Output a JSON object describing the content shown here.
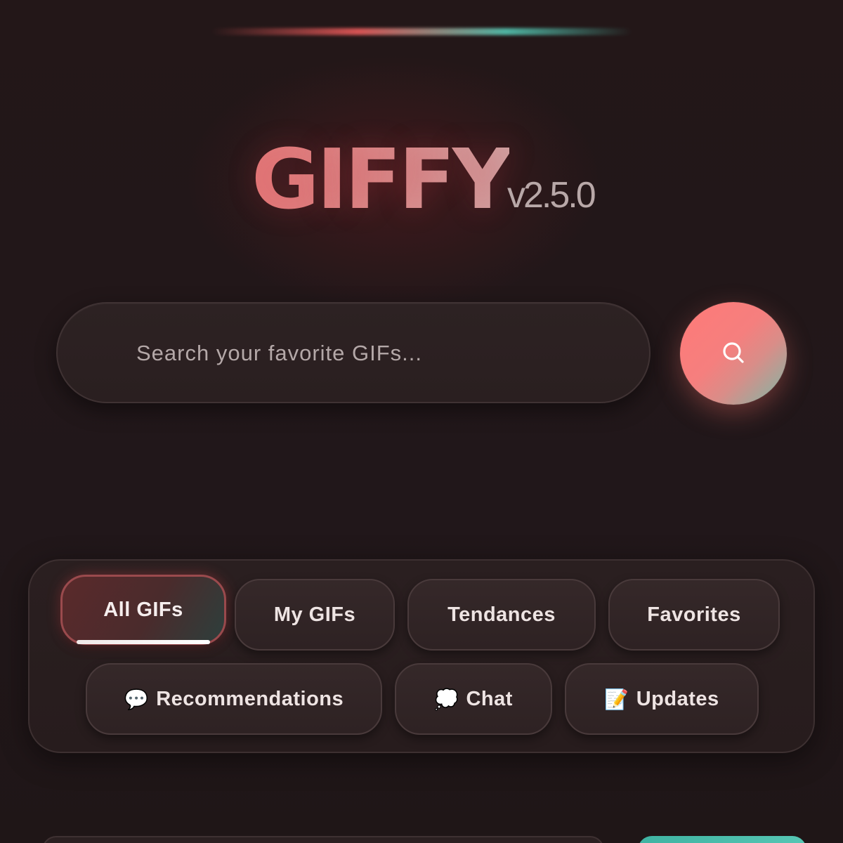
{
  "brand": {
    "name": "GIFFY",
    "version": "v2.5.0"
  },
  "search": {
    "placeholder": "Search your favorite GIFs...",
    "value": "",
    "button_icon": "search-icon"
  },
  "tabs": {
    "row1": [
      {
        "label": "All GIFs",
        "active": true
      },
      {
        "label": "My GIFs",
        "active": false
      },
      {
        "label": "Tendances",
        "active": false
      },
      {
        "label": "Favorites",
        "active": false
      }
    ],
    "row2": [
      {
        "label": "Recommendations",
        "icon": "💬",
        "icon_name": "speech-bubble-icon"
      },
      {
        "label": "Chat",
        "icon": "💭",
        "icon_name": "thought-bubble-icon"
      },
      {
        "label": "Updates",
        "icon": "📝",
        "icon_name": "memo-icon"
      }
    ]
  },
  "colors": {
    "background": "#1f1516",
    "accent_coral": "#ff7a78",
    "accent_teal": "#56c6b4",
    "logo": "#e47a7a"
  }
}
